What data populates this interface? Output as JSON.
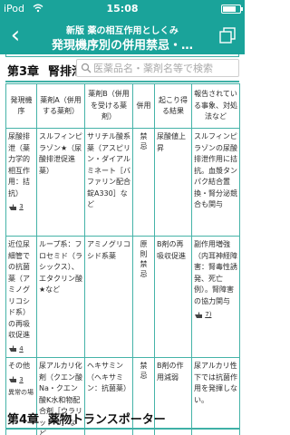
{
  "status_bar": {
    "carrier": "iPod",
    "time": "15:08"
  },
  "nav": {
    "back_symbol": "‹",
    "title_line1": "新版 薬の相互作用としくみ",
    "title_line2": "発現機序別の併用禁忌・…"
  },
  "search": {
    "placeholder": "医薬品名・薬剤名等で検索"
  },
  "chapter3": {
    "number": "第3章",
    "title": "腎排泄"
  },
  "chapter4": {
    "number": "第4章",
    "title": "薬物トランスポーター"
  },
  "table": {
    "headers": [
      "発現機序",
      "薬剤A（併用する薬剤）",
      "薬剤B（併用を受ける薬剤）",
      "併用",
      "起こり得る結果",
      "報告されている事象、対処法など"
    ],
    "rows": [
      {
        "mechanism": "尿酸排泄（薬力学的相互作用：拮抗）",
        "ref": "3",
        "drug_a": "スルフィンピラゾン★（尿酸排泄促進薬）",
        "drug_b": "サリチル酸系薬（アスピリン・ダイアルミネート［バファリン配合錠A330］など",
        "use": "禁忌",
        "result": "尿酸値上昇",
        "notes": "スルフィンピラゾンの尿酸排泄作用に拮抗。血漿タンパク結合置換・腎分泌競合も関与"
      },
      {
        "mechanism": "近位尿細管での抗菌薬（アミノグリコシド系）の再吸収促進",
        "ref": "4",
        "drug_a": "ループ系：フロセミド（ラシックス）、エタクリン酸★など",
        "drug_b": "アミノグリコシド系薬",
        "use": "原則禁忌",
        "result": "B剤の再吸収促進",
        "notes": "副作用増強（内耳神経障害：腎毒性誘発、死亡例）。腎障害の協力関与",
        "notes_ref": "7)"
      },
      {
        "mechanism": "その他",
        "ref": "3",
        "ref_extra": "異常の場",
        "drug_a": "尿アルカリ化剤（クエン酸Na・クエン酸K水和物配合剤［ウラリット-U］など",
        "drug_b": "ヘキサミン（ヘキサミン：抗菌薬）",
        "use": "禁忌",
        "result": "B剤の作用減弱",
        "notes": "尿アルカリ性下では抗菌作用を発揮しない。"
      }
    ]
  },
  "colors": {
    "header_teal": "#1aa39a",
    "table_border": "#45b3a8",
    "background": "#ffffff"
  },
  "icons": [
    "wifi-icon",
    "battery-icon",
    "back-arrow-icon",
    "windows-icon",
    "search-icon",
    "hand-pointer-icon"
  ]
}
